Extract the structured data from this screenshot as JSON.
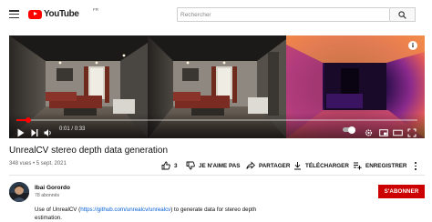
{
  "masthead": {
    "logo_text": "YouTube",
    "country_code": "FR",
    "search_placeholder": "Rechercher",
    "icons": [
      "menu-icon",
      "youtube-logo-icon",
      "search-icon"
    ]
  },
  "player": {
    "time_current": "0:01",
    "time_total": "0:33",
    "time_separator": " / ",
    "progress_fraction": 0.03,
    "icons": [
      "info-icon",
      "play-icon",
      "next-icon",
      "volume-icon",
      "autoplay-toggle",
      "settings-icon",
      "miniplayer-icon",
      "theater-icon",
      "fullscreen-icon"
    ]
  },
  "video": {
    "title": "UnrealCV stereo depth data generation",
    "views": "348 vues",
    "bullet": " • ",
    "date": "5 sept. 2021"
  },
  "actions": {
    "like_count": "3",
    "dislike_label": "JE N'AIME PAS",
    "share_label": "PARTAGER",
    "download_label": "TÉLÉCHARGER",
    "save_label": "ENREGISTRER"
  },
  "channel": {
    "name": "Ibai Gorordo",
    "subscribers": "78 abonnés",
    "subscribe_label": "S'ABONNER"
  },
  "description": {
    "prefix": "Use of UnrealCV (",
    "link": "https://github.com/unrealcv/unrealcv",
    "suffix": ") to generate data for stereo depth estimation."
  },
  "colors": {
    "brand_red": "#ff0000",
    "subscribe_red": "#cc0000",
    "link_blue": "#065fd4",
    "text_secondary": "#606060"
  }
}
